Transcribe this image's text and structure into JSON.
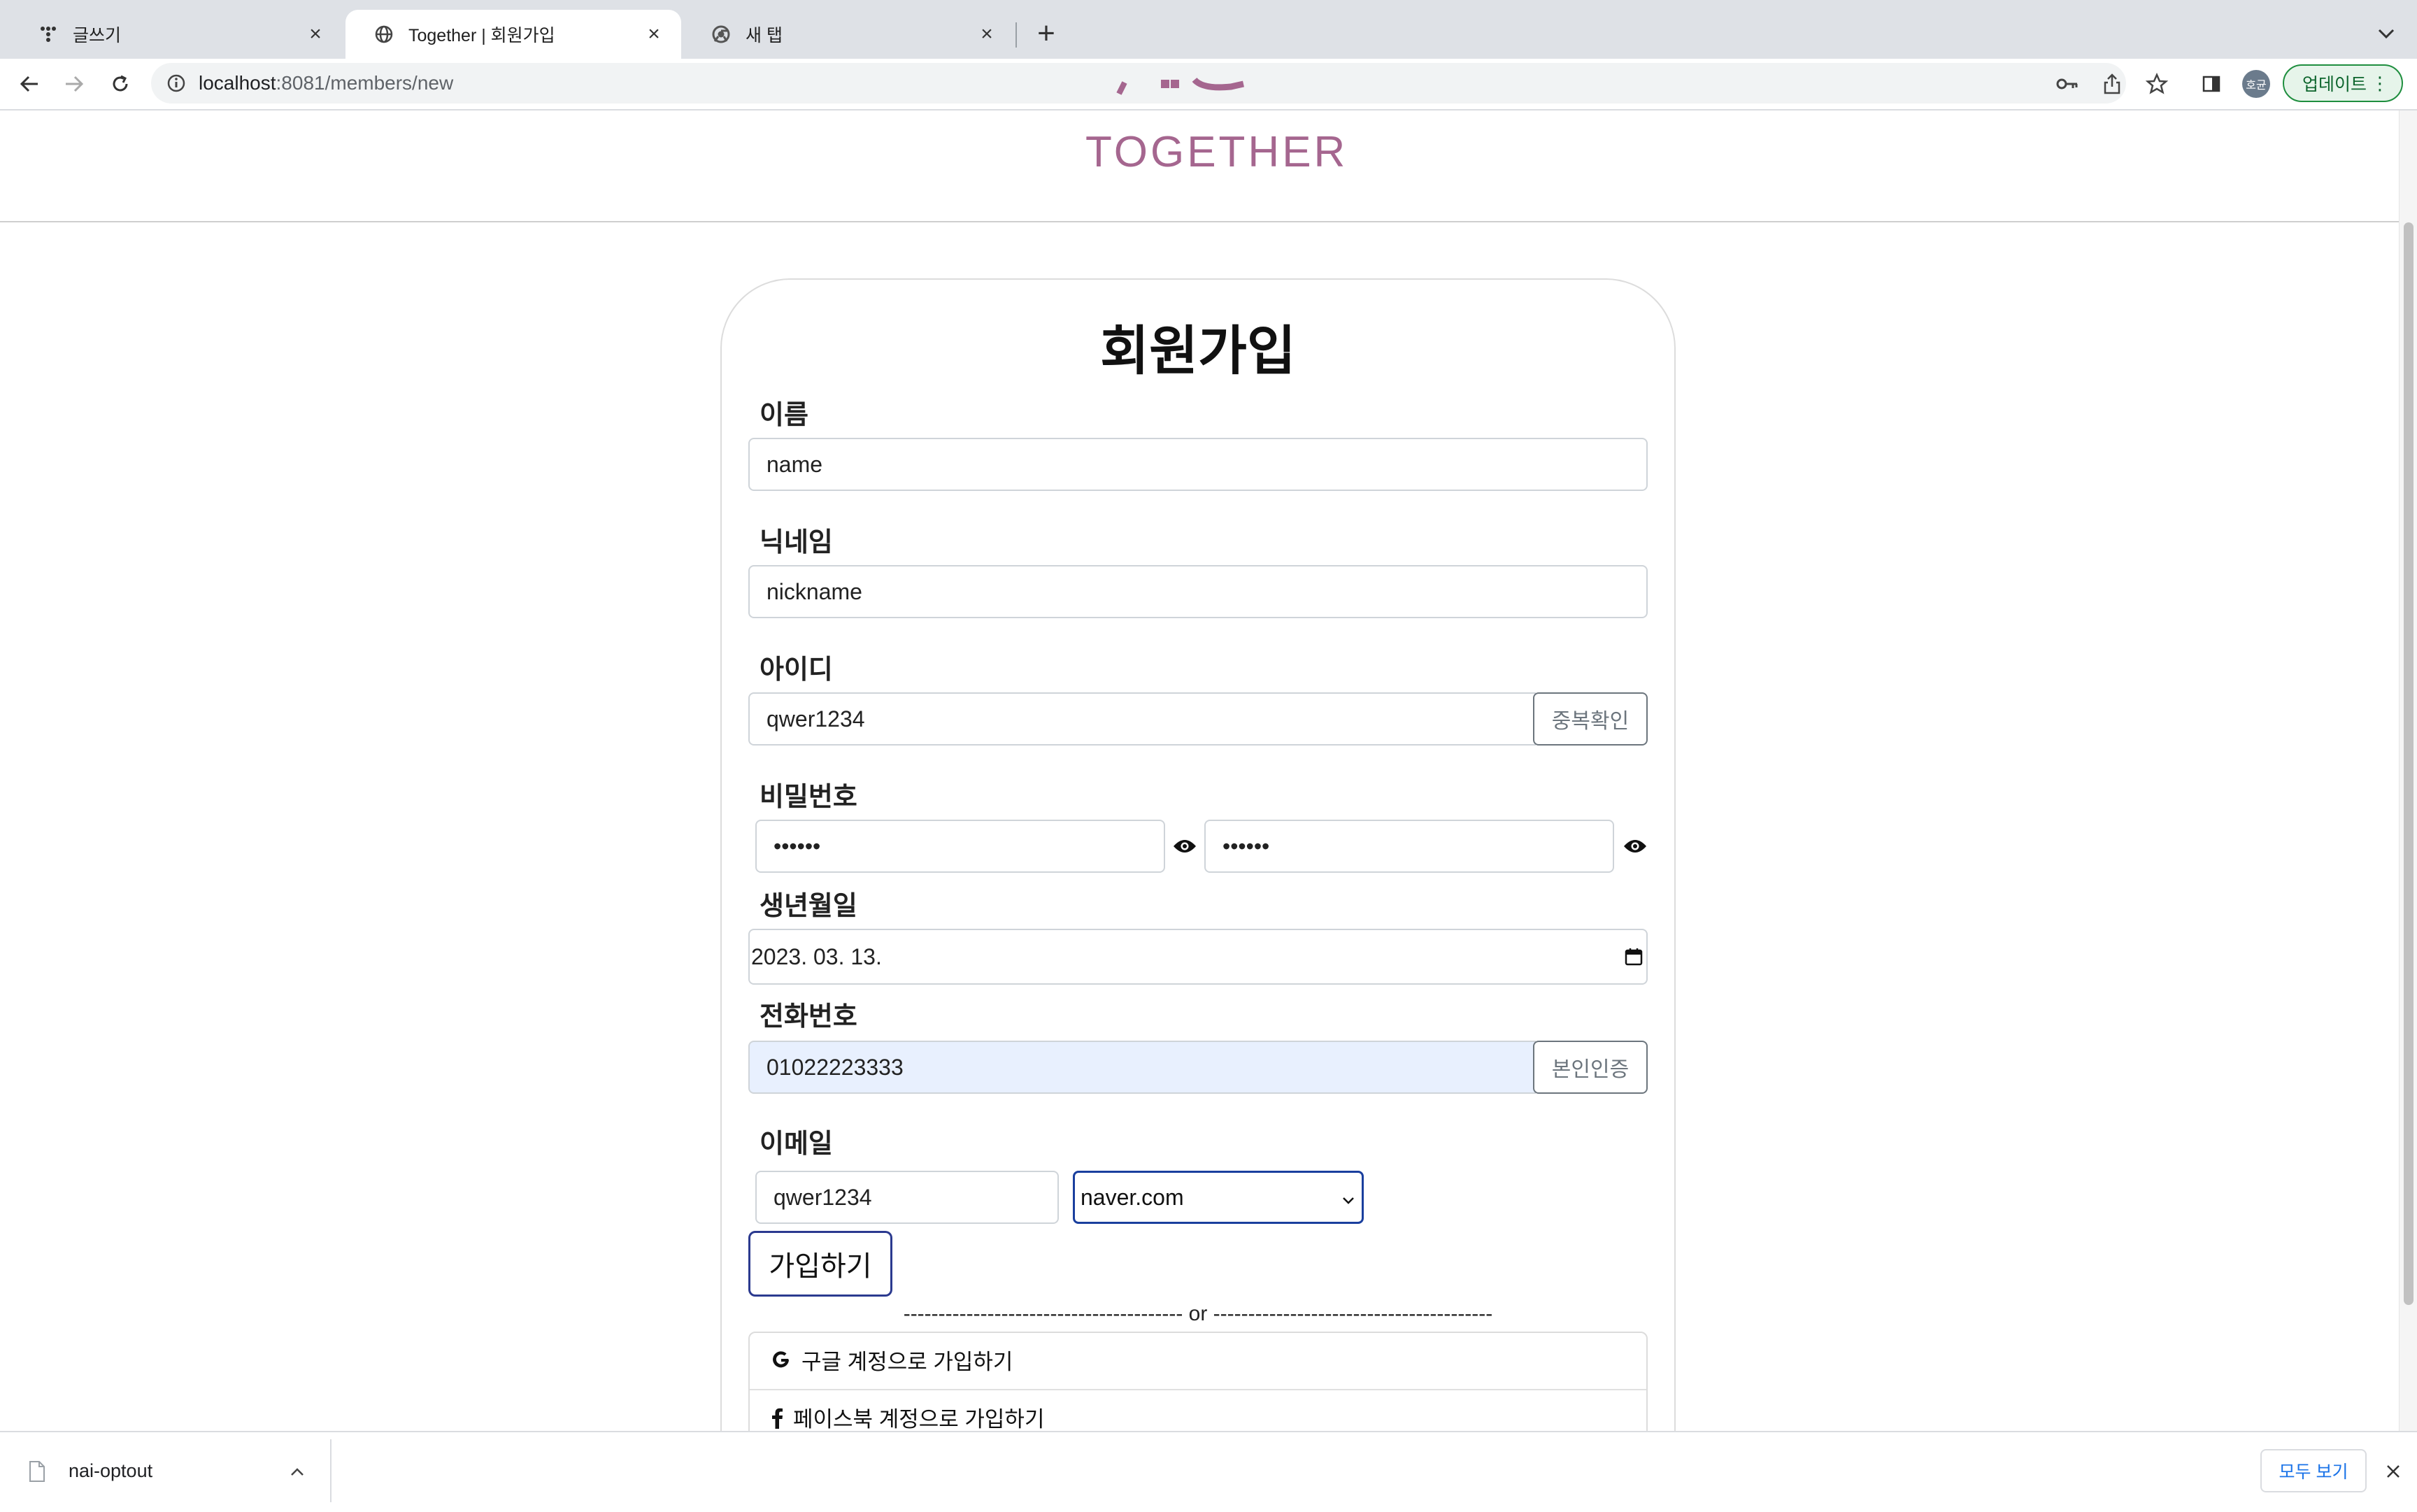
{
  "browser": {
    "tabs": [
      {
        "title": "글쓰기",
        "icon": "app-icon"
      },
      {
        "title": "Together | 회원가입",
        "icon": "globe-icon"
      },
      {
        "title": "새 탭",
        "icon": "chrome-icon"
      }
    ],
    "url_host": "localhost",
    "url_path": ":8081/members/new",
    "avatar_text": "호균",
    "update_label": "업데이트"
  },
  "header": {
    "logo_text": "TOGETHER"
  },
  "form": {
    "title": "회원가입",
    "name_label": "이름",
    "name_value": "name",
    "nickname_label": "닉네임",
    "nickname_value": "nickname",
    "id_label": "아이디",
    "id_value": "qwer1234",
    "id_check_label": "중복확인",
    "password_label": "비밀번호",
    "password_value": "••••••",
    "password_confirm_value": "••••••",
    "birth_label": "생년월일",
    "birth_value": "2023. 03. 13.",
    "phone_label": "전화번호",
    "phone_value": "01022223333",
    "phone_verify_label": "본인인증",
    "email_label": "이메일",
    "email_local": "qwer1234",
    "email_domain": "naver.com",
    "submit_label": "가입하기",
    "divider_text": "---------------------------------------- or ----------------------------------------",
    "google_label": "구글 계정으로 가입하기",
    "facebook_label": "페이스북 계정으로 가입하기"
  },
  "downloads": {
    "file_name": "nai-optout",
    "show_all_label": "모두 보기"
  },
  "colors": {
    "brand": "#a5668f",
    "submit_border": "#2b3a8f",
    "select_border": "#1a3f9e",
    "autofill": "#e8f0fe"
  }
}
